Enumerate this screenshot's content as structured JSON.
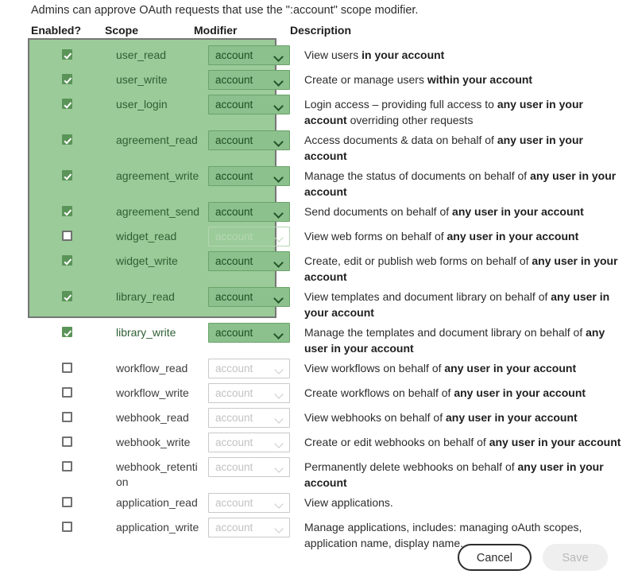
{
  "intro": {
    "text": "Admins can approve OAuth requests that use the \":account\" scope modifier."
  },
  "table": {
    "headers": {
      "enabled": "Enabled?",
      "scope": "Scope",
      "modifier": "Modifier",
      "description": "Description"
    },
    "rows": [
      {
        "scope": "user_read",
        "enabled": true,
        "modifier": "account",
        "modifier_enabled": true,
        "highlighted": true,
        "desc_pre": "View users ",
        "desc_bold": "in your account",
        "desc_post": ""
      },
      {
        "scope": "user_write",
        "enabled": true,
        "modifier": "account",
        "modifier_enabled": true,
        "highlighted": true,
        "desc_pre": "Create or manage users ",
        "desc_bold": "within your account",
        "desc_post": ""
      },
      {
        "scope": "user_login",
        "enabled": true,
        "modifier": "account",
        "modifier_enabled": true,
        "highlighted": true,
        "desc_pre": "Login access – providing full access to ",
        "desc_bold": "any user in your account",
        "desc_post": " overriding other requests"
      },
      {
        "scope": "agreement_read",
        "enabled": true,
        "modifier": "account",
        "modifier_enabled": true,
        "highlighted": true,
        "desc_pre": "Access documents & data on behalf of ",
        "desc_bold": "any user in your account",
        "desc_post": ""
      },
      {
        "scope": "agreement_write",
        "enabled": true,
        "modifier": "account",
        "modifier_enabled": true,
        "highlighted": true,
        "desc_pre": "Manage the status of documents on behalf of ",
        "desc_bold": "any user in your account",
        "desc_post": ""
      },
      {
        "scope": "agreement_send",
        "enabled": true,
        "modifier": "account",
        "modifier_enabled": true,
        "highlighted": true,
        "desc_pre": "Send documents on behalf of ",
        "desc_bold": "any user in your account",
        "desc_post": ""
      },
      {
        "scope": "widget_read",
        "enabled": false,
        "modifier": "account",
        "modifier_enabled": false,
        "highlighted": true,
        "desc_pre": "View web forms on behalf of ",
        "desc_bold": "any user in your account",
        "desc_post": ""
      },
      {
        "scope": "widget_write",
        "enabled": true,
        "modifier": "account",
        "modifier_enabled": true,
        "highlighted": true,
        "desc_pre": "Create, edit or publish web forms on behalf of ",
        "desc_bold": "any user in your account",
        "desc_post": ""
      },
      {
        "scope": "library_read",
        "enabled": true,
        "modifier": "account",
        "modifier_enabled": true,
        "highlighted": true,
        "desc_pre": "View templates and document library on behalf of ",
        "desc_bold": "any user in your account",
        "desc_post": ""
      },
      {
        "scope": "library_write",
        "enabled": true,
        "modifier": "account",
        "modifier_enabled": true,
        "highlighted": true,
        "desc_pre": "Manage the templates and document library on behalf of ",
        "desc_bold": "any user in your account",
        "desc_post": ""
      },
      {
        "scope": "workflow_read",
        "enabled": false,
        "modifier": "account",
        "modifier_enabled": false,
        "highlighted": false,
        "desc_pre": "View workflows on behalf of ",
        "desc_bold": "any user in your account",
        "desc_post": ""
      },
      {
        "scope": "workflow_write",
        "enabled": false,
        "modifier": "account",
        "modifier_enabled": false,
        "highlighted": false,
        "desc_pre": "Create workflows on behalf of ",
        "desc_bold": "any user in your account",
        "desc_post": ""
      },
      {
        "scope": "webhook_read",
        "enabled": false,
        "modifier": "account",
        "modifier_enabled": false,
        "highlighted": false,
        "desc_pre": "View webhooks on behalf of ",
        "desc_bold": "any user in your account",
        "desc_post": ""
      },
      {
        "scope": "webhook_write",
        "enabled": false,
        "modifier": "account",
        "modifier_enabled": false,
        "highlighted": false,
        "desc_pre": "Create or edit webhooks on behalf of ",
        "desc_bold": "any user in your account",
        "desc_post": ""
      },
      {
        "scope": "webhook_retention",
        "enabled": false,
        "modifier": "account",
        "modifier_enabled": false,
        "highlighted": false,
        "desc_pre": "Permanently delete webhooks on behalf of ",
        "desc_bold": "any user in your account",
        "desc_post": ""
      },
      {
        "scope": "application_read",
        "enabled": false,
        "modifier": "account",
        "modifier_enabled": false,
        "highlighted": false,
        "desc_pre": "View applications.",
        "desc_bold": "",
        "desc_post": ""
      },
      {
        "scope": "application_write",
        "enabled": false,
        "modifier": "account",
        "modifier_enabled": false,
        "highlighted": false,
        "desc_pre": "Manage applications, includes: managing oAuth scopes, application name, display name.",
        "desc_bold": "",
        "desc_post": ""
      }
    ]
  },
  "footer": {
    "cancel_label": "Cancel",
    "save_label": "Save"
  },
  "colors": {
    "highlight_green": "#9acb98",
    "checkbox_green": "#5b9458",
    "select_green": "#8cc08c",
    "disabled_grey": "#c2c2c2"
  }
}
